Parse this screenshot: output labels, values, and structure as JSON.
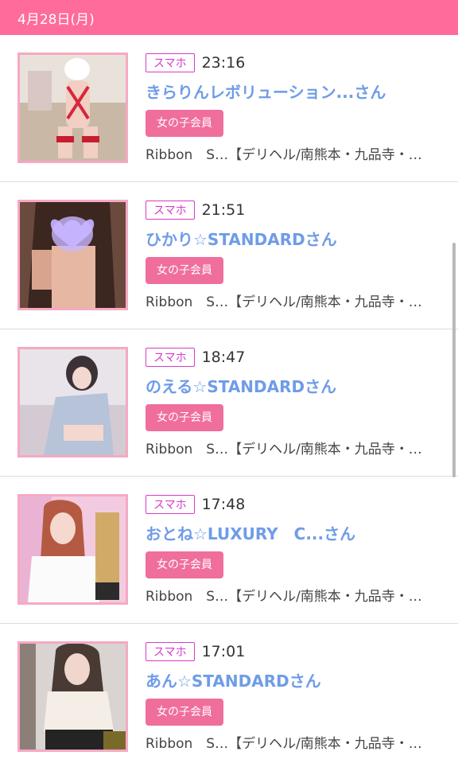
{
  "header": {
    "date": "4月28日(月)"
  },
  "entries": [
    {
      "device": "スマホ",
      "time": "23:16",
      "name": "きらりんレボリューション...さん",
      "member": "女の子会員",
      "shop": "Ribbon　S…【デリヘル/南熊本・九品寺・…"
    },
    {
      "device": "スマホ",
      "time": "21:51",
      "name": "ひかり☆STANDARDさん",
      "member": "女の子会員",
      "shop": "Ribbon　S…【デリヘル/南熊本・九品寺・…"
    },
    {
      "device": "スマホ",
      "time": "18:47",
      "name": "のえる☆STANDARDさん",
      "member": "女の子会員",
      "shop": "Ribbon　S…【デリヘル/南熊本・九品寺・…"
    },
    {
      "device": "スマホ",
      "time": "17:48",
      "name": "おとね☆LUXURY　C...さん",
      "member": "女の子会員",
      "shop": "Ribbon　S…【デリヘル/南熊本・九品寺・…"
    },
    {
      "device": "スマホ",
      "time": "17:01",
      "name": "あん☆STANDARDさん",
      "member": "女の子会員",
      "shop": "Ribbon　S…【デリヘル/南熊本・九品寺・…"
    }
  ],
  "colors": {
    "header": "#ff6b9a",
    "name": "#6f9ce8",
    "device_badge": "#d63cc9",
    "member_badge": "#f06e9c",
    "thumb_border": "#f6a9c3"
  }
}
